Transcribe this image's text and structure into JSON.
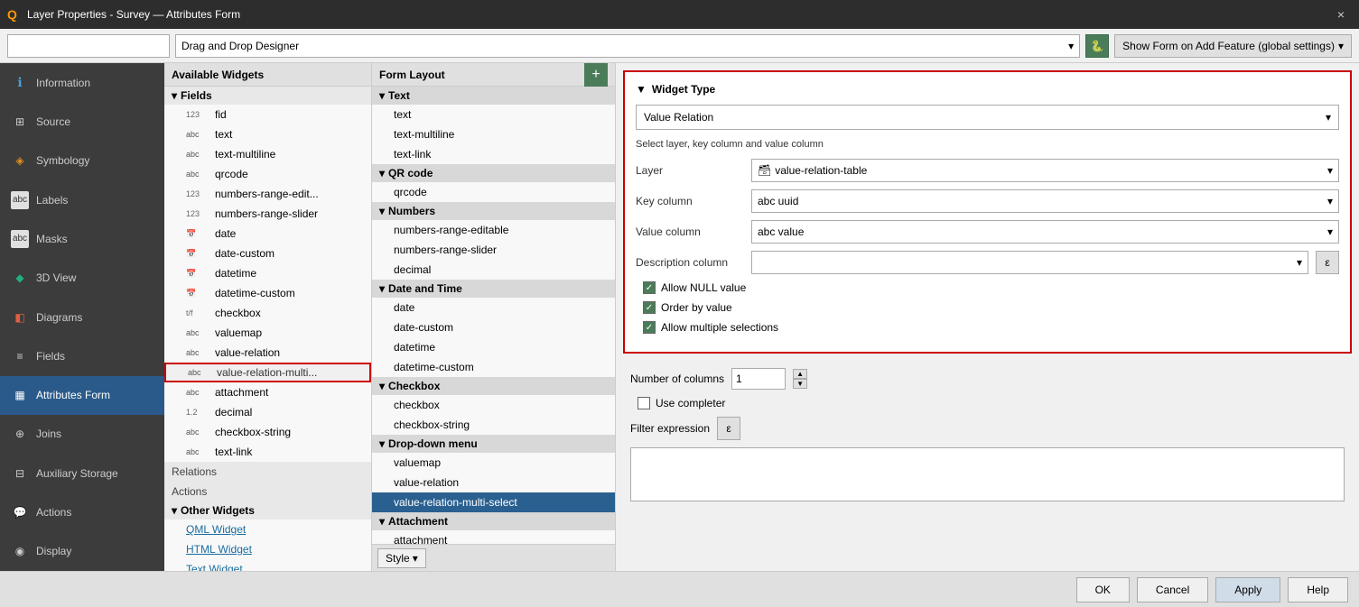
{
  "titlebar": {
    "title": "Layer Properties - Survey — Attributes Form",
    "icon": "Q",
    "close_label": "×"
  },
  "topbar": {
    "search_placeholder": "",
    "designer_dropdown": "Drag and Drop Designer",
    "python_label": "🐍",
    "form_btn": "Show Form on Add Feature (global settings)"
  },
  "sidebar": {
    "items": [
      {
        "id": "information",
        "label": "Information",
        "icon": "ℹ"
      },
      {
        "id": "source",
        "label": "Source",
        "icon": "⊞"
      },
      {
        "id": "symbology",
        "label": "Symbology",
        "icon": "◈"
      },
      {
        "id": "labels",
        "label": "Labels",
        "icon": "abc"
      },
      {
        "id": "masks",
        "label": "Masks",
        "icon": "abc"
      },
      {
        "id": "3dview",
        "label": "3D View",
        "icon": "◆"
      },
      {
        "id": "diagrams",
        "label": "Diagrams",
        "icon": "◧"
      },
      {
        "id": "fields",
        "label": "Fields",
        "icon": "≡"
      },
      {
        "id": "attributes-form",
        "label": "Attributes Form",
        "icon": "▦",
        "active": true
      },
      {
        "id": "joins",
        "label": "Joins",
        "icon": "⊕"
      },
      {
        "id": "auxiliary-storage",
        "label": "Auxiliary Storage",
        "icon": "⊟"
      },
      {
        "id": "actions",
        "label": "Actions",
        "icon": "💬"
      },
      {
        "id": "display",
        "label": "Display",
        "icon": "◉"
      }
    ]
  },
  "available_widgets": {
    "header": "Available Widgets",
    "fields_group": "Fields",
    "fields": [
      {
        "type": "123",
        "name": "fid"
      },
      {
        "type": "abc",
        "name": "text"
      },
      {
        "type": "abc",
        "name": "text-multiline"
      },
      {
        "type": "abc",
        "name": "qrcode"
      },
      {
        "type": "123",
        "name": "numbers-range-edit..."
      },
      {
        "type": "123",
        "name": "numbers-range-slider"
      },
      {
        "type": "cal",
        "name": "date"
      },
      {
        "type": "cal",
        "name": "date-custom"
      },
      {
        "type": "cal",
        "name": "datetime"
      },
      {
        "type": "cal",
        "name": "datetime-custom"
      },
      {
        "type": "t/f",
        "name": "checkbox"
      },
      {
        "type": "abc",
        "name": "valuemap"
      },
      {
        "type": "abc",
        "name": "value-relation"
      },
      {
        "type": "abc",
        "name": "value-relation-multi...",
        "selected": true,
        "highlighted": true
      },
      {
        "type": "abc",
        "name": "attachment"
      },
      {
        "type": "1.2",
        "name": "decimal"
      },
      {
        "type": "abc",
        "name": "checkbox-string"
      },
      {
        "type": "abc",
        "name": "text-link"
      }
    ],
    "relations_label": "Relations",
    "actions_label": "Actions",
    "other_group": "Other Widgets",
    "other_items": [
      {
        "name": "QML Widget",
        "link": true
      },
      {
        "name": "HTML Widget",
        "link": true
      },
      {
        "name": "Text Widget",
        "link": true
      }
    ]
  },
  "form_layout": {
    "header": "Form Layout",
    "add_btn": "+",
    "groups": [
      {
        "name": "Text",
        "items": [
          "text",
          "text-multiline",
          "text-link"
        ]
      },
      {
        "name": "QR code",
        "items": [
          "qrcode"
        ]
      },
      {
        "name": "Numbers",
        "items": [
          "numbers-range-editable",
          "numbers-range-slider",
          "decimal"
        ]
      },
      {
        "name": "Date and Time",
        "items": [
          "date",
          "date-custom",
          "datetime",
          "datetime-custom"
        ]
      },
      {
        "name": "Checkbox",
        "items": [
          "checkbox",
          "checkbox-string"
        ]
      },
      {
        "name": "Drop-down menu",
        "items": [
          "valuemap",
          "value-relation",
          "value-relation-multi-select"
        ]
      },
      {
        "name": "Attachment",
        "items": [
          "attachment"
        ]
      }
    ],
    "selected_item": "value-relation-multi-select",
    "style_btn": "Style",
    "style_arrow": "▾"
  },
  "widget_type": {
    "header": "Widget Type",
    "type_value": "Value Relation",
    "description": "Select layer, key column and value column",
    "layer_label": "Layer",
    "layer_value": "value-relation-table",
    "key_label": "Key column",
    "key_value": "abc uuid",
    "value_label": "Value column",
    "value_value": "abc value",
    "description_col_label": "Description column",
    "description_col_value": "",
    "allow_null": true,
    "allow_null_label": "Allow NULL value",
    "order_by": true,
    "order_by_label": "Order by value",
    "allow_multiple": true,
    "allow_multiple_label": "Allow multiple selections",
    "num_cols_label": "Number of columns",
    "num_cols_value": "1",
    "use_completer": false,
    "use_completer_label": "Use completer",
    "filter_label": "Filter expression",
    "filter_expr_btn": "ε"
  },
  "bottom": {
    "ok_label": "OK",
    "cancel_label": "Cancel",
    "apply_label": "Apply",
    "help_label": "Help"
  }
}
